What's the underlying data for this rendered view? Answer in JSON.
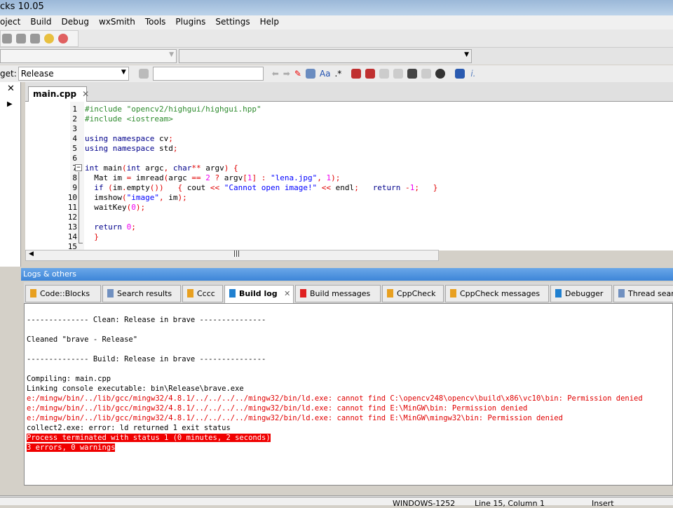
{
  "title": "cks 10.05",
  "menu": [
    "oject",
    "Build",
    "Debug",
    "wxSmith",
    "Tools",
    "Plugins",
    "Settings",
    "Help"
  ],
  "target": {
    "label": "get:",
    "value": "Release"
  },
  "editor": {
    "tab": "main.cpp",
    "lines": [
      [
        [
          "pp",
          "#include \"opencv2/highgui/highgui.hpp\""
        ]
      ],
      [
        [
          "pp",
          "#include <iostream>"
        ]
      ],
      [],
      [
        [
          "kw",
          "using namespace"
        ],
        [
          "tx",
          " cv"
        ],
        [
          "op",
          ";"
        ]
      ],
      [
        [
          "kw",
          "using namespace"
        ],
        [
          "tx",
          " std"
        ],
        [
          "op",
          ";"
        ]
      ],
      [],
      [
        [
          "kw",
          "int"
        ],
        [
          "tx",
          " main"
        ],
        [
          "op",
          "("
        ],
        [
          "kw",
          "int"
        ],
        [
          "tx",
          " argc"
        ],
        [
          "op",
          ", "
        ],
        [
          "kw",
          "char"
        ],
        [
          "op",
          "**"
        ],
        [
          "tx",
          " argv"
        ],
        [
          "op",
          ") {"
        ]
      ],
      [
        [
          "tx",
          "  Mat im "
        ],
        [
          "op",
          "="
        ],
        [
          "tx",
          " imread"
        ],
        [
          "op",
          "("
        ],
        [
          "tx",
          "argc "
        ],
        [
          "op",
          "=="
        ],
        [
          "nu",
          " 2"
        ],
        [
          "op",
          " ?"
        ],
        [
          "tx",
          " argv"
        ],
        [
          "op",
          "["
        ],
        [
          "nu",
          "1"
        ],
        [
          "op",
          "] :"
        ],
        [
          "st",
          " \"lena.jpg\""
        ],
        [
          "op",
          ", "
        ],
        [
          "nu",
          "1"
        ],
        [
          "op",
          ");"
        ]
      ],
      [
        [
          "kw",
          "  if"
        ],
        [
          "op",
          " ("
        ],
        [
          "tx",
          "im"
        ],
        [
          "op",
          "."
        ],
        [
          "tx",
          "empty"
        ],
        [
          "op",
          "())   {"
        ],
        [
          "tx",
          " cout "
        ],
        [
          "op",
          "<<"
        ],
        [
          "st",
          " \"Cannot open image!\""
        ],
        [
          "op",
          " <<"
        ],
        [
          "tx",
          " endl"
        ],
        [
          "op",
          ";   "
        ],
        [
          "kw",
          "return"
        ],
        [
          "op",
          " -"
        ],
        [
          "nu",
          "1"
        ],
        [
          "op",
          ";   }"
        ]
      ],
      [
        [
          "tx",
          "  imshow"
        ],
        [
          "op",
          "("
        ],
        [
          "st",
          "\"image\""
        ],
        [
          "op",
          ", "
        ],
        [
          "tx",
          "im"
        ],
        [
          "op",
          ");"
        ]
      ],
      [
        [
          "tx",
          "  waitKey"
        ],
        [
          "op",
          "("
        ],
        [
          "nu",
          "0"
        ],
        [
          "op",
          ");"
        ]
      ],
      [],
      [
        [
          "kw",
          "  return"
        ],
        [
          "nu",
          " 0"
        ],
        [
          "op",
          ";"
        ]
      ],
      [
        [
          "op",
          "  }"
        ]
      ],
      []
    ]
  },
  "logs": {
    "header": "Logs & others",
    "tabs": [
      "Code::Blocks",
      "Search results",
      "Cccc",
      "Build log",
      "Build messages",
      "CppCheck",
      "CppCheck messages",
      "Debugger",
      "Thread search"
    ],
    "lines": [
      {
        "t": "-------------- Clean: Release in brave ---------------",
        "c": ""
      },
      {
        "t": "",
        "c": ""
      },
      {
        "t": "Cleaned \"brave - Release\"",
        "c": ""
      },
      {
        "t": "",
        "c": ""
      },
      {
        "t": "-------------- Build: Release in brave ---------------",
        "c": ""
      },
      {
        "t": "",
        "c": ""
      },
      {
        "t": "Compiling: main.cpp",
        "c": ""
      },
      {
        "t": "Linking console executable: bin\\Release\\brave.exe",
        "c": ""
      },
      {
        "t": "e:/mingw/bin/../lib/gcc/mingw32/4.8.1/../../../../mingw32/bin/ld.exe: cannot find C:\\opencv248\\opencv\\build\\x86\\vc10\\bin: Permission denied",
        "c": "red"
      },
      {
        "t": "e:/mingw/bin/../lib/gcc/mingw32/4.8.1/../../../../mingw32/bin/ld.exe: cannot find E:\\MinGW\\bin: Permission denied",
        "c": "red"
      },
      {
        "t": "e:/mingw/bin/../lib/gcc/mingw32/4.8.1/../../../../mingw32/bin/ld.exe: cannot find E:\\MinGW\\mingw32\\bin: Permission denied",
        "c": "red"
      },
      {
        "t": "collect2.exe: error: ld returned 1 exit status",
        "c": ""
      },
      {
        "t": "Process terminated with status 1 (0 minutes, 2 seconds)",
        "c": "hl"
      },
      {
        "t": "3 errors, 0 warnings",
        "c": "hl"
      }
    ]
  },
  "status": {
    "encoding": "WINDOWS-1252",
    "position": "Line 15, Column 1",
    "mode": "Insert"
  }
}
